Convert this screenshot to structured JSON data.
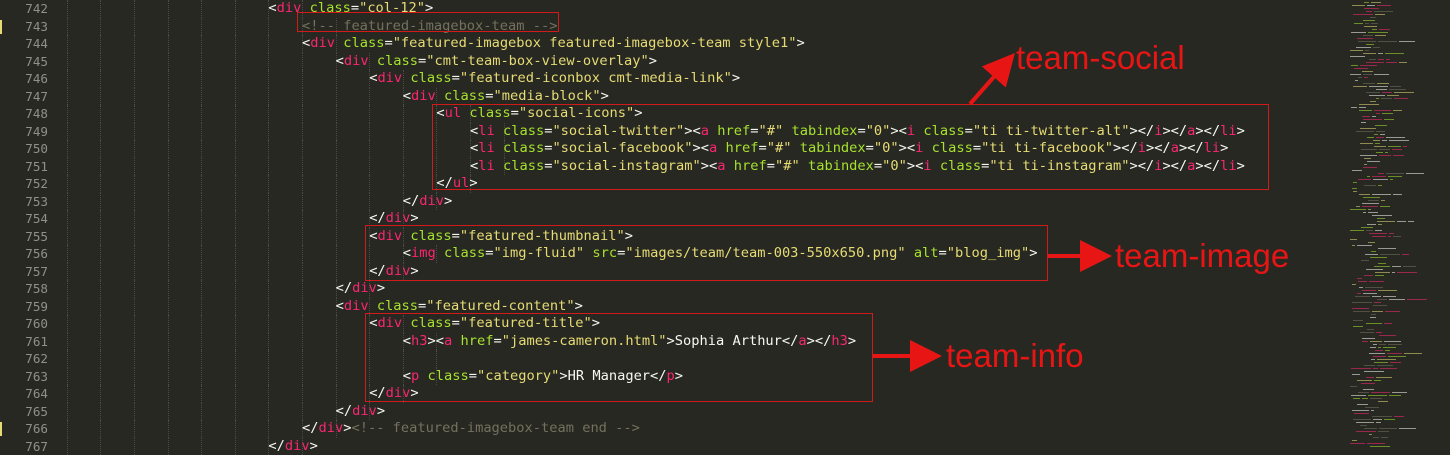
{
  "editor": {
    "line_numbers": [
      "742",
      "743",
      "744",
      "745",
      "746",
      "747",
      "748",
      "749",
      "750",
      "751",
      "752",
      "753",
      "754",
      "755",
      "756",
      "757",
      "758",
      "759",
      "760",
      "761",
      "762",
      "763",
      "764",
      "765",
      "766",
      "767"
    ],
    "lines": [
      {
        "indent": 8,
        "parts": [
          [
            "p",
            "<"
          ],
          [
            "t",
            "div"
          ],
          [
            "p",
            " "
          ],
          [
            "a",
            "class"
          ],
          [
            "p",
            "="
          ],
          [
            "s",
            "\"col-12\""
          ],
          [
            "p",
            ">"
          ]
        ]
      },
      {
        "indent": 9,
        "parts": [
          [
            "c",
            "<!-- featured-imagebox-team -->"
          ]
        ]
      },
      {
        "indent": 9,
        "parts": [
          [
            "p",
            "<"
          ],
          [
            "t",
            "div"
          ],
          [
            "p",
            " "
          ],
          [
            "a",
            "class"
          ],
          [
            "p",
            "="
          ],
          [
            "s",
            "\"featured-imagebox featured-imagebox-team style1\""
          ],
          [
            "p",
            ">"
          ]
        ]
      },
      {
        "indent": 10,
        "parts": [
          [
            "p",
            "<"
          ],
          [
            "t",
            "div"
          ],
          [
            "p",
            " "
          ],
          [
            "a",
            "class"
          ],
          [
            "p",
            "="
          ],
          [
            "s",
            "\"cmt-team-box-view-overlay\""
          ],
          [
            "p",
            ">"
          ]
        ]
      },
      {
        "indent": 11,
        "parts": [
          [
            "p",
            "<"
          ],
          [
            "t",
            "div"
          ],
          [
            "p",
            " "
          ],
          [
            "a",
            "class"
          ],
          [
            "p",
            "="
          ],
          [
            "s",
            "\"featured-iconbox cmt-media-link\""
          ],
          [
            "p",
            ">"
          ]
        ]
      },
      {
        "indent": 12,
        "parts": [
          [
            "p",
            "<"
          ],
          [
            "t",
            "div"
          ],
          [
            "p",
            " "
          ],
          [
            "a",
            "class"
          ],
          [
            "p",
            "="
          ],
          [
            "s",
            "\"media-block\""
          ],
          [
            "p",
            ">"
          ]
        ]
      },
      {
        "indent": 13,
        "parts": [
          [
            "p",
            "<"
          ],
          [
            "t",
            "ul"
          ],
          [
            "p",
            " "
          ],
          [
            "a",
            "class"
          ],
          [
            "p",
            "="
          ],
          [
            "s",
            "\"social-icons\""
          ],
          [
            "p",
            ">"
          ]
        ]
      },
      {
        "indent": 14,
        "parts": [
          [
            "p",
            "<"
          ],
          [
            "t",
            "li"
          ],
          [
            "p",
            " "
          ],
          [
            "a",
            "class"
          ],
          [
            "p",
            "="
          ],
          [
            "s",
            "\"social-twitter\""
          ],
          [
            "p",
            ">"
          ],
          [
            "p",
            "<"
          ],
          [
            "t",
            "a"
          ],
          [
            "p",
            " "
          ],
          [
            "a",
            "href"
          ],
          [
            "p",
            "="
          ],
          [
            "s",
            "\"#\""
          ],
          [
            "p",
            " "
          ],
          [
            "a",
            "tabindex"
          ],
          [
            "p",
            "="
          ],
          [
            "s",
            "\"0\""
          ],
          [
            "p",
            ">"
          ],
          [
            "p",
            "<"
          ],
          [
            "t",
            "i"
          ],
          [
            "p",
            " "
          ],
          [
            "a",
            "class"
          ],
          [
            "p",
            "="
          ],
          [
            "s",
            "\"ti ti-twitter-alt\""
          ],
          [
            "p",
            "></"
          ],
          [
            "t",
            "i"
          ],
          [
            "p",
            "></"
          ],
          [
            "t",
            "a"
          ],
          [
            "p",
            "></"
          ],
          [
            "t",
            "li"
          ],
          [
            "p",
            ">"
          ]
        ]
      },
      {
        "indent": 14,
        "parts": [
          [
            "p",
            "<"
          ],
          [
            "t",
            "li"
          ],
          [
            "p",
            " "
          ],
          [
            "a",
            "class"
          ],
          [
            "p",
            "="
          ],
          [
            "s",
            "\"social-facebook\""
          ],
          [
            "p",
            ">"
          ],
          [
            "p",
            "<"
          ],
          [
            "t",
            "a"
          ],
          [
            "p",
            " "
          ],
          [
            "a",
            "href"
          ],
          [
            "p",
            "="
          ],
          [
            "s",
            "\"#\""
          ],
          [
            "p",
            " "
          ],
          [
            "a",
            "tabindex"
          ],
          [
            "p",
            "="
          ],
          [
            "s",
            "\"0\""
          ],
          [
            "p",
            ">"
          ],
          [
            "p",
            "<"
          ],
          [
            "t",
            "i"
          ],
          [
            "p",
            " "
          ],
          [
            "a",
            "class"
          ],
          [
            "p",
            "="
          ],
          [
            "s",
            "\"ti ti-facebook\""
          ],
          [
            "p",
            "></"
          ],
          [
            "t",
            "i"
          ],
          [
            "p",
            "></"
          ],
          [
            "t",
            "a"
          ],
          [
            "p",
            "></"
          ],
          [
            "t",
            "li"
          ],
          [
            "p",
            ">"
          ]
        ]
      },
      {
        "indent": 14,
        "parts": [
          [
            "p",
            "<"
          ],
          [
            "t",
            "li"
          ],
          [
            "p",
            " "
          ],
          [
            "a",
            "class"
          ],
          [
            "p",
            "="
          ],
          [
            "s",
            "\"social-instagram\""
          ],
          [
            "p",
            ">"
          ],
          [
            "p",
            "<"
          ],
          [
            "t",
            "a"
          ],
          [
            "p",
            " "
          ],
          [
            "a",
            "href"
          ],
          [
            "p",
            "="
          ],
          [
            "s",
            "\"#\""
          ],
          [
            "p",
            " "
          ],
          [
            "a",
            "tabindex"
          ],
          [
            "p",
            "="
          ],
          [
            "s",
            "\"0\""
          ],
          [
            "p",
            ">"
          ],
          [
            "p",
            "<"
          ],
          [
            "t",
            "i"
          ],
          [
            "p",
            " "
          ],
          [
            "a",
            "class"
          ],
          [
            "p",
            "="
          ],
          [
            "s",
            "\"ti ti-instagram\""
          ],
          [
            "p",
            "></"
          ],
          [
            "t",
            "i"
          ],
          [
            "p",
            "></"
          ],
          [
            "t",
            "a"
          ],
          [
            "p",
            "></"
          ],
          [
            "t",
            "li"
          ],
          [
            "p",
            ">"
          ]
        ]
      },
      {
        "indent": 13,
        "parts": [
          [
            "p",
            "</"
          ],
          [
            "t",
            "ul"
          ],
          [
            "p",
            ">"
          ]
        ]
      },
      {
        "indent": 12,
        "parts": [
          [
            "p",
            "</"
          ],
          [
            "t",
            "div"
          ],
          [
            "p",
            ">"
          ]
        ]
      },
      {
        "indent": 11,
        "parts": [
          [
            "p",
            "</"
          ],
          [
            "t",
            "div"
          ],
          [
            "p",
            ">"
          ]
        ]
      },
      {
        "indent": 11,
        "parts": [
          [
            "p",
            "<"
          ],
          [
            "t",
            "div"
          ],
          [
            "p",
            " "
          ],
          [
            "a",
            "class"
          ],
          [
            "p",
            "="
          ],
          [
            "s",
            "\"featured-thumbnail\""
          ],
          [
            "p",
            ">"
          ]
        ]
      },
      {
        "indent": 12,
        "parts": [
          [
            "p",
            "<"
          ],
          [
            "t",
            "img"
          ],
          [
            "p",
            " "
          ],
          [
            "a",
            "class"
          ],
          [
            "p",
            "="
          ],
          [
            "s",
            "\"img-fluid\""
          ],
          [
            "p",
            " "
          ],
          [
            "a",
            "src"
          ],
          [
            "p",
            "="
          ],
          [
            "s",
            "\"images/team/team-003-550x650.png\""
          ],
          [
            "p",
            " "
          ],
          [
            "a",
            "alt"
          ],
          [
            "p",
            "="
          ],
          [
            "s",
            "\"blog_img\""
          ],
          [
            "p",
            ">"
          ]
        ]
      },
      {
        "indent": 11,
        "parts": [
          [
            "p",
            "</"
          ],
          [
            "t",
            "div"
          ],
          [
            "p",
            ">"
          ]
        ]
      },
      {
        "indent": 10,
        "parts": [
          [
            "p",
            "</"
          ],
          [
            "t",
            "div"
          ],
          [
            "p",
            ">"
          ]
        ]
      },
      {
        "indent": 10,
        "parts": [
          [
            "p",
            "<"
          ],
          [
            "t",
            "div"
          ],
          [
            "p",
            " "
          ],
          [
            "a",
            "class"
          ],
          [
            "p",
            "="
          ],
          [
            "s",
            "\"featured-content\""
          ],
          [
            "p",
            ">"
          ]
        ]
      },
      {
        "indent": 11,
        "parts": [
          [
            "p",
            "<"
          ],
          [
            "t",
            "div"
          ],
          [
            "p",
            " "
          ],
          [
            "a",
            "class"
          ],
          [
            "p",
            "="
          ],
          [
            "s",
            "\"featured-title\""
          ],
          [
            "p",
            ">"
          ]
        ]
      },
      {
        "indent": 12,
        "parts": [
          [
            "p",
            "<"
          ],
          [
            "t",
            "h3"
          ],
          [
            "p",
            "><"
          ],
          [
            "t",
            "a"
          ],
          [
            "p",
            " "
          ],
          [
            "a",
            "href"
          ],
          [
            "p",
            "="
          ],
          [
            "s",
            "\"james-cameron.html\""
          ],
          [
            "p",
            ">Sophia Arthur</"
          ],
          [
            "t",
            "a"
          ],
          [
            "p",
            "></"
          ],
          [
            "t",
            "h3"
          ],
          [
            "p",
            ">"
          ]
        ]
      },
      {
        "indent": 12,
        "parts": []
      },
      {
        "indent": 12,
        "parts": [
          [
            "p",
            "<"
          ],
          [
            "t",
            "p"
          ],
          [
            "p",
            " "
          ],
          [
            "a",
            "class"
          ],
          [
            "p",
            "="
          ],
          [
            "s",
            "\"category\""
          ],
          [
            "p",
            ">HR Manager</"
          ],
          [
            "t",
            "p"
          ],
          [
            "p",
            ">"
          ]
        ]
      },
      {
        "indent": 11,
        "parts": [
          [
            "p",
            "</"
          ],
          [
            "t",
            "div"
          ],
          [
            "p",
            ">"
          ]
        ]
      },
      {
        "indent": 10,
        "parts": [
          [
            "p",
            "</"
          ],
          [
            "t",
            "div"
          ],
          [
            "p",
            ">"
          ]
        ]
      },
      {
        "indent": 9,
        "parts": [
          [
            "p",
            "</"
          ],
          [
            "t",
            "div"
          ],
          [
            "p",
            ">"
          ],
          [
            "c",
            "<!-- featured-imagebox-team end -->"
          ]
        ]
      },
      {
        "indent": 8,
        "parts": [
          [
            "p",
            "</"
          ],
          [
            "t",
            "div"
          ],
          [
            "p",
            ">"
          ]
        ]
      }
    ],
    "modified_lines": [
      "743",
      "766"
    ]
  },
  "annotations": {
    "team_social": "team-social",
    "team_image": "team-image",
    "team_info": "team-info"
  },
  "colors": {
    "background": "#272822",
    "tag": "#f92672",
    "attribute": "#a6e22e",
    "string": "#e6db74",
    "comment": "#75715e",
    "plain": "#f8f8f2",
    "annotation": "#e81515"
  }
}
